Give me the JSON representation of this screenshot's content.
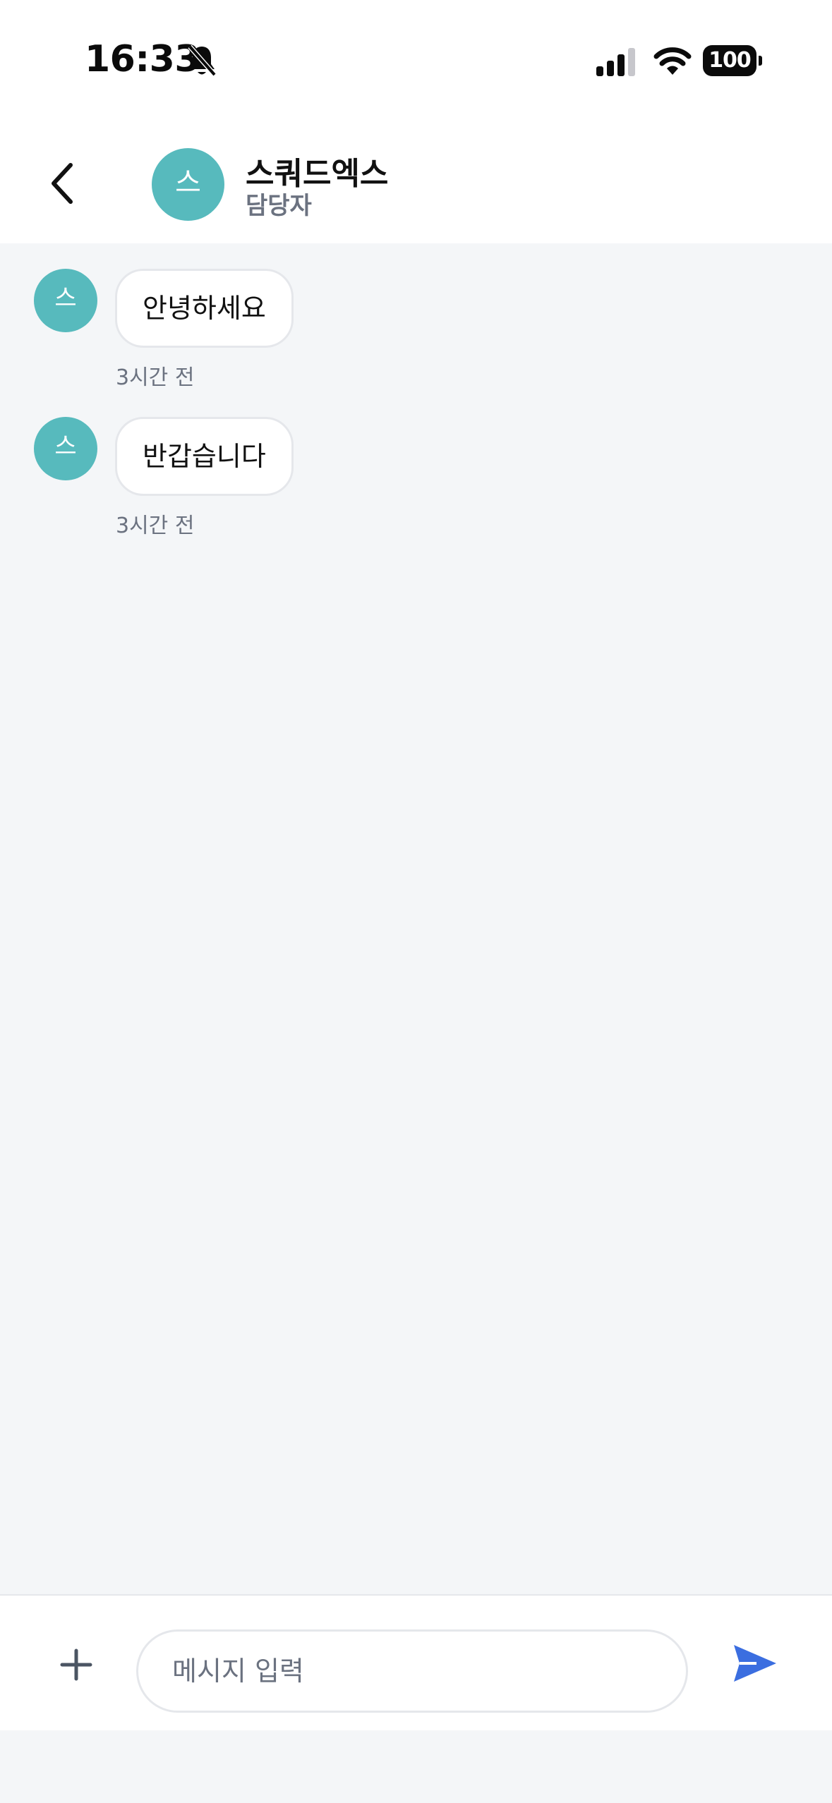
{
  "status_bar": {
    "time": "16:33",
    "battery": "100",
    "icons": [
      "bell-slash-icon",
      "signal-icon",
      "wifi-icon",
      "battery-icon"
    ]
  },
  "header": {
    "back_icon": "chevron-left-icon",
    "avatar_initial": "스",
    "name": "스쿼드엑스",
    "role": "담당자"
  },
  "messages": [
    {
      "avatar_initial": "스",
      "text": "안녕하세요",
      "time": "3시간 전"
    },
    {
      "avatar_initial": "스",
      "text": "반갑습니다",
      "time": "3시간 전"
    }
  ],
  "input_bar": {
    "add_icon": "plus-icon",
    "placeholder": "메시지 입력",
    "value": "",
    "send_icon": "send-icon"
  },
  "colors": {
    "avatar": "#57babd",
    "send": "#3b6ee0",
    "background": "#f4f6f8",
    "muted_text": "#6b7280"
  }
}
